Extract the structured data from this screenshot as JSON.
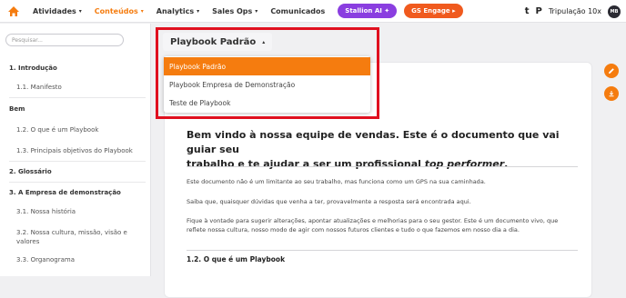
{
  "nav": {
    "items": [
      {
        "label": "Atividades",
        "caret": "▾",
        "active": false
      },
      {
        "label": "Conteúdos",
        "caret": "▾",
        "active": true
      },
      {
        "label": "Analytics",
        "caret": "▾",
        "active": false
      },
      {
        "label": "Sales Ops",
        "caret": "▾",
        "active": false
      },
      {
        "label": "Comunicados",
        "caret": "",
        "active": false
      }
    ],
    "stallion_label": "Stallion AI ✦",
    "engage_label": "GS Engage ▸",
    "tr_t": "t",
    "tr_p": "P",
    "team": "Tripulação 10x",
    "avatar": "MB",
    "accent": "#f57c0f"
  },
  "sidebar": {
    "search_placeholder": "Pesquisar...",
    "items": [
      {
        "label": "1. Introdução",
        "level": 1
      },
      {
        "label": "1.1. Manifesto",
        "level": 2
      },
      {
        "label": "Bem",
        "level": 1
      },
      {
        "label": "1.2. O que é um Playbook",
        "level": 2
      },
      {
        "label": "1.3. Principais objetivos do Playbook",
        "level": 2
      },
      {
        "label": "2. Glossário",
        "level": 1
      },
      {
        "label": "3. A Empresa de demonstração",
        "level": 1
      },
      {
        "label": "3.1. Nossa história",
        "level": 2
      },
      {
        "label": "3.2. Nossa cultura, missão, visão e",
        "level": 2
      },
      {
        "label": "valores",
        "level": 2
      },
      {
        "label": "3.3. Organograma",
        "level": 2
      }
    ]
  },
  "playbook": {
    "selected": "Playbook Padrão",
    "options": [
      "Playbook Padrão",
      "Playbook Empresa de Demonstração",
      "Teste de Playbook"
    ]
  },
  "document": {
    "title_line1": "Bem vindo à nossa equipe de vendas. Este é o documento que vai guiar seu",
    "title_line2_pre": "trabalho e te ajudar a ser um profissional ",
    "title_line2_em": "top performer",
    "title_line2_post": ".",
    "para1": "Este documento não é um limitante ao seu trabalho, mas funciona como um GPS na sua caminhada.",
    "para2": "Saiba que, quaisquer dúvidas que venha a ter, provavelmente a resposta será encontrada aqui.",
    "para3": "Fique à vontade para sugerir alterações, apontar atualizações e melhorias para o seu gestor. Este é um documento vivo, que reflete nossa cultura, nosso modo de agir com nossos futuros clientes e tudo o que fazemos em nosso dia a dia.",
    "section_heading": "1.2. O que é um Playbook"
  },
  "icons": {
    "logo": "house-logo-icon",
    "edit": "pencil-icon",
    "download": "download-icon"
  }
}
